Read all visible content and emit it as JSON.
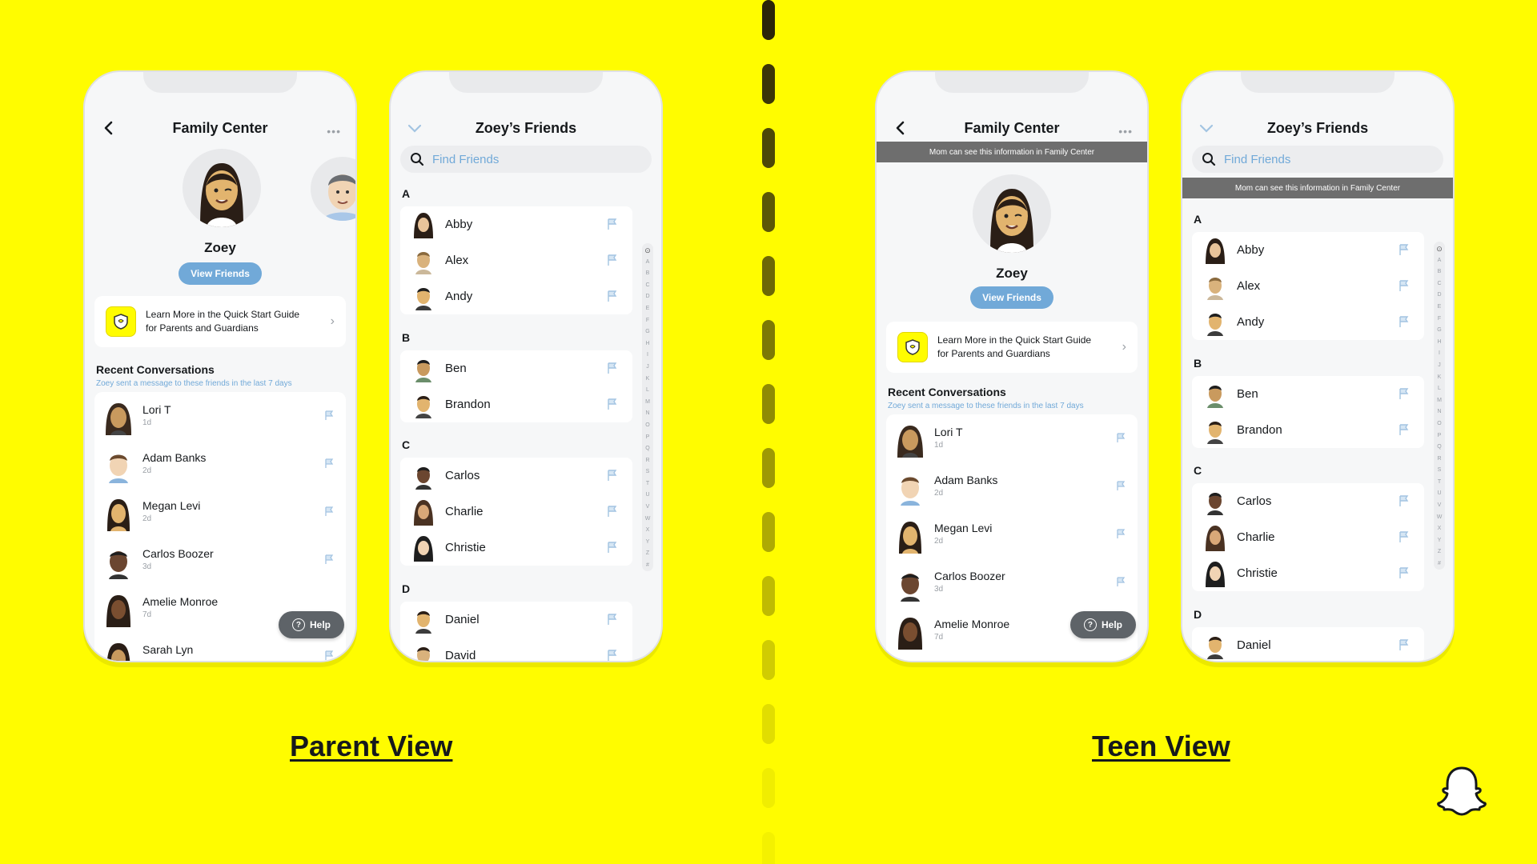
{
  "labels": {
    "parent_view": "Parent View",
    "teen_view": "Teen View"
  },
  "family_center": {
    "title": "Family Center",
    "more": "•••",
    "banner": "Mom can see this information in Family Center",
    "profile_name": "Zoey",
    "view_friends": "View Friends",
    "guide_line1": "Learn More in the Quick Start Guide",
    "guide_line2": "for Parents and Guardians",
    "recent_title": "Recent Conversations",
    "recent_sub": "Zoey sent a message to these friends in the last 7 days",
    "help": "Help",
    "help_icon": "?",
    "guide_chevron": "›",
    "conversations": [
      {
        "name": "Lori T",
        "time": "1d"
      },
      {
        "name": "Adam Banks",
        "time": "2d"
      },
      {
        "name": "Megan Levi",
        "time": "2d"
      },
      {
        "name": "Carlos Boozer",
        "time": "3d"
      },
      {
        "name": "Amelie Monroe",
        "time": "7d"
      },
      {
        "name": "Sarah Lyn",
        "time": ""
      }
    ]
  },
  "friends": {
    "title": "Zoey’s Friends",
    "search_placeholder": "Find Friends",
    "banner": "Mom can see this information in Family Center",
    "groups": [
      {
        "letter": "A",
        "names": [
          "Abby",
          "Alex",
          "Andy"
        ]
      },
      {
        "letter": "B",
        "names": [
          "Ben",
          "Brandon"
        ]
      },
      {
        "letter": "C",
        "names": [
          "Carlos",
          "Charlie",
          "Christie"
        ]
      },
      {
        "letter": "D",
        "names": [
          "Daniel",
          "David"
        ]
      }
    ],
    "index": [
      "A",
      "B",
      "C",
      "D",
      "E",
      "F",
      "G",
      "H",
      "I",
      "J",
      "K",
      "L",
      "M",
      "N",
      "O",
      "P",
      "Q",
      "R",
      "S",
      "T",
      "U",
      "V",
      "W",
      "X",
      "Y",
      "Z",
      "#"
    ]
  },
  "colors": {
    "brand_yellow": "#FFFC00",
    "accent_blue": "#71A9D8",
    "banner_gray": "#6E6E6E"
  },
  "icons": [
    "back-chevron-icon",
    "more-dots-icon",
    "down-chevron-icon",
    "search-icon",
    "flag-icon",
    "help-icon",
    "snapchat-ghost-icon",
    "guide-shield-icon"
  ]
}
